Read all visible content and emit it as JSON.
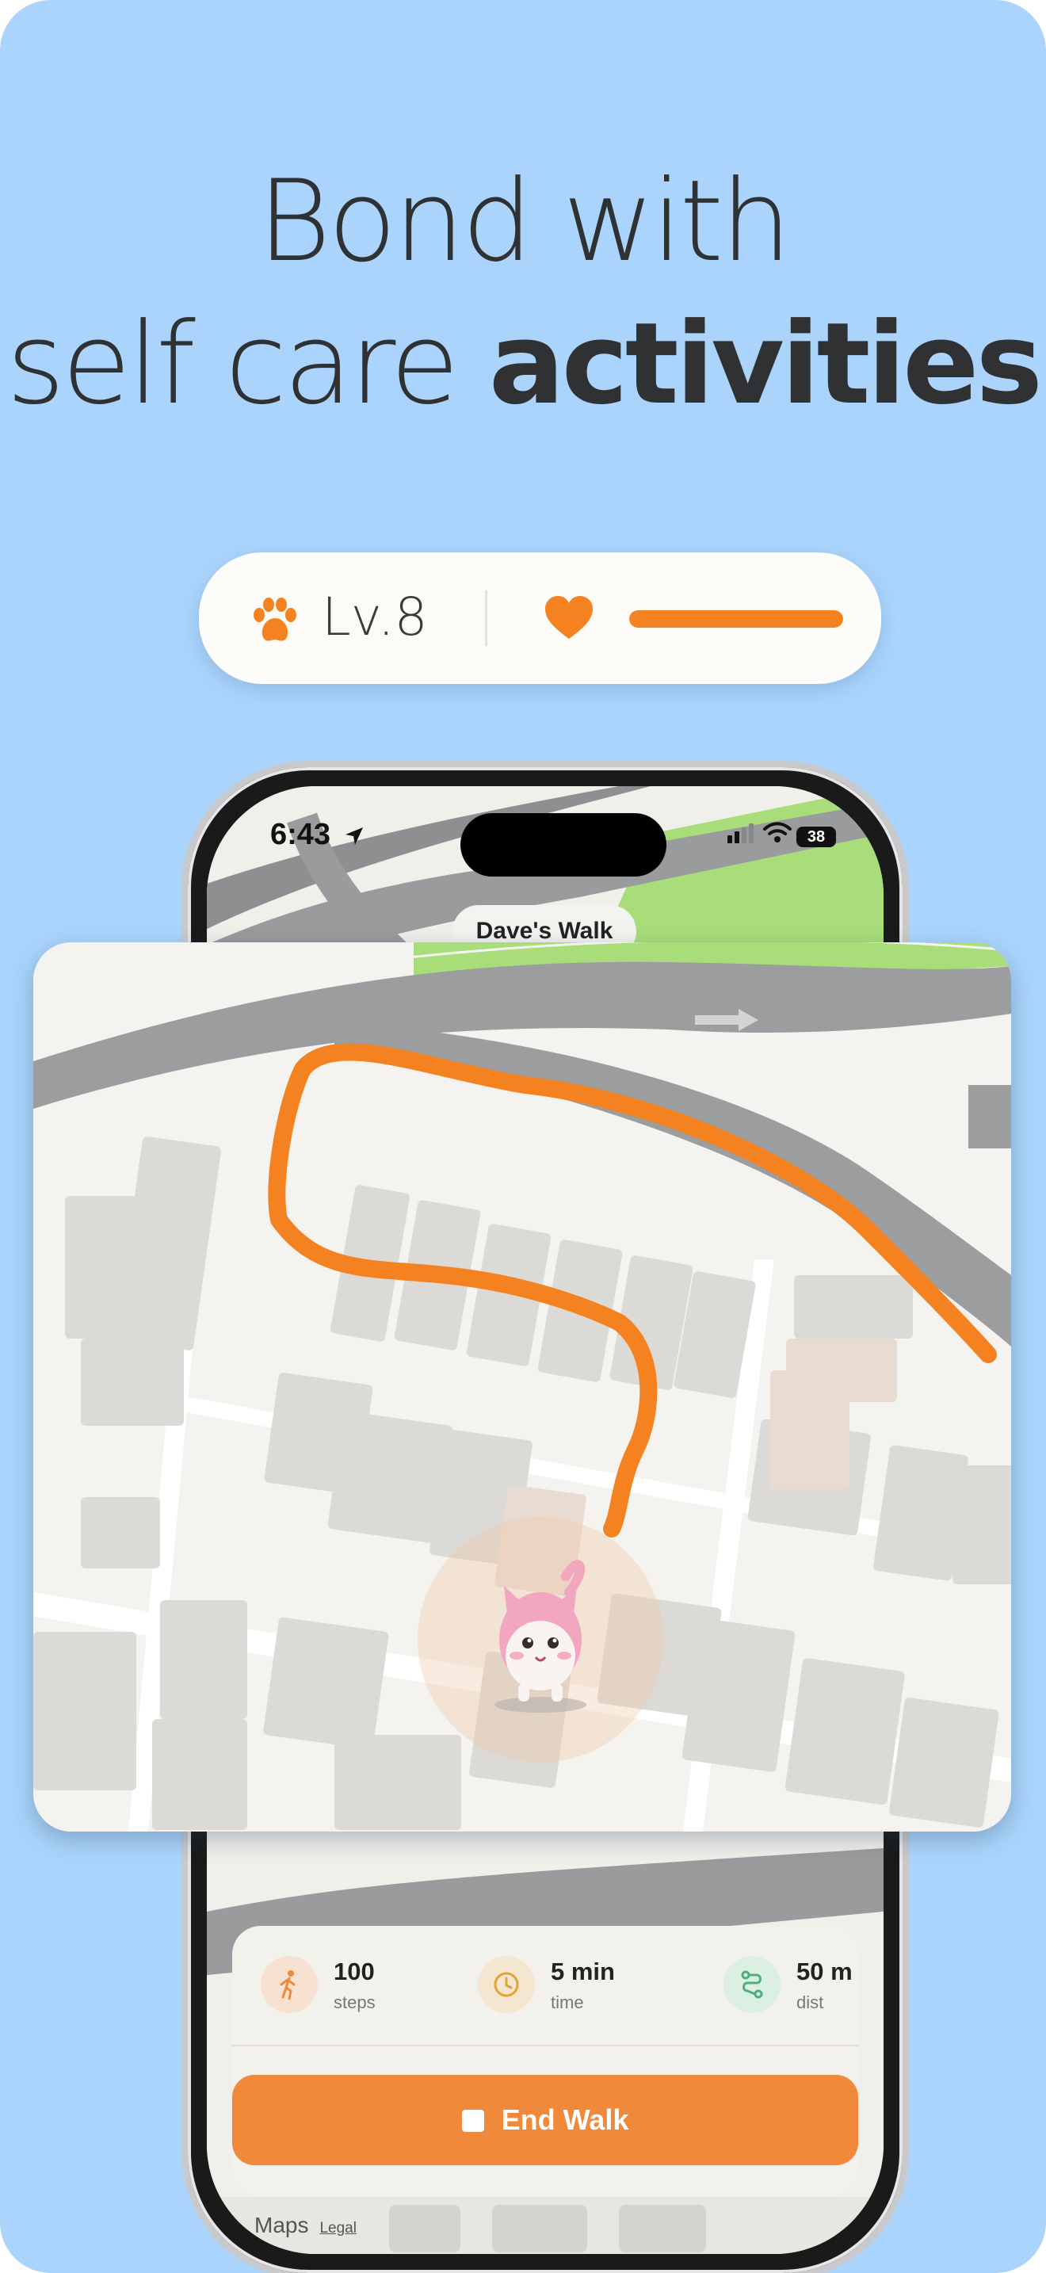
{
  "headline": {
    "line1": "Bond with",
    "line2_regular": "self care ",
    "line2_bold": "activities"
  },
  "level_card": {
    "level_text": "Lv.8",
    "affection_progress": 1.0,
    "accent_color": "#f58220",
    "paw_icon": "paw-icon",
    "heart_icon": "heart-icon"
  },
  "status_bar": {
    "time": "6:43",
    "battery": "38"
  },
  "walk": {
    "title": "Dave's Walk"
  },
  "stats": [
    {
      "value": "100",
      "unit": "steps",
      "icon": "walking-icon",
      "color": "#f0893a"
    },
    {
      "value": "5 min",
      "unit": "time",
      "icon": "clock-icon",
      "color": "#e2a23a"
    },
    {
      "value": "50 m",
      "unit": "dist",
      "icon": "route-icon",
      "color": "#4caf7d"
    }
  ],
  "actions": {
    "end_walk": "End Walk"
  },
  "map_footer": {
    "maps": "Maps",
    "legal": "Legal"
  },
  "colors": {
    "background": "#aad4fb",
    "route": "#f58220",
    "button": "#f0893a"
  }
}
